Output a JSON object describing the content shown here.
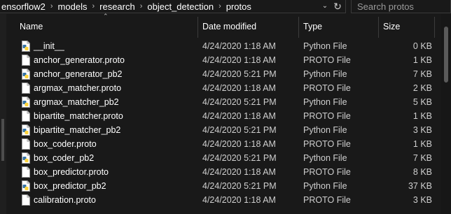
{
  "address_bar": {
    "crumbs": [
      "ensorflow2",
      "models",
      "research",
      "object_detection",
      "protos"
    ],
    "separator": "›"
  },
  "search": {
    "placeholder": "Search protos"
  },
  "columns": {
    "name": "Name",
    "date": "Date modified",
    "type": "Type",
    "size": "Size"
  },
  "files": [
    {
      "name": "__init__",
      "date": "4/24/2020 1:18 AM",
      "type": "Python File",
      "size": "0 KB",
      "icon": "python-file-icon"
    },
    {
      "name": "anchor_generator.proto",
      "date": "4/24/2020 1:18 AM",
      "type": "PROTO File",
      "size": "1 KB",
      "icon": "proto-file-icon"
    },
    {
      "name": "anchor_generator_pb2",
      "date": "4/24/2020 5:21 PM",
      "type": "Python File",
      "size": "7 KB",
      "icon": "python-file-icon"
    },
    {
      "name": "argmax_matcher.proto",
      "date": "4/24/2020 1:18 AM",
      "type": "PROTO File",
      "size": "2 KB",
      "icon": "proto-file-icon"
    },
    {
      "name": "argmax_matcher_pb2",
      "date": "4/24/2020 5:21 PM",
      "type": "Python File",
      "size": "5 KB",
      "icon": "python-file-icon"
    },
    {
      "name": "bipartite_matcher.proto",
      "date": "4/24/2020 1:18 AM",
      "type": "PROTO File",
      "size": "1 KB",
      "icon": "proto-file-icon"
    },
    {
      "name": "bipartite_matcher_pb2",
      "date": "4/24/2020 5:21 PM",
      "type": "Python File",
      "size": "3 KB",
      "icon": "python-file-icon"
    },
    {
      "name": "box_coder.proto",
      "date": "4/24/2020 1:18 AM",
      "type": "PROTO File",
      "size": "1 KB",
      "icon": "proto-file-icon"
    },
    {
      "name": "box_coder_pb2",
      "date": "4/24/2020 5:21 PM",
      "type": "Python File",
      "size": "7 KB",
      "icon": "python-file-icon"
    },
    {
      "name": "box_predictor.proto",
      "date": "4/24/2020 1:18 AM",
      "type": "PROTO File",
      "size": "8 KB",
      "icon": "proto-file-icon"
    },
    {
      "name": "box_predictor_pb2",
      "date": "4/24/2020 5:21 PM",
      "type": "Python File",
      "size": "37 KB",
      "icon": "python-file-icon"
    },
    {
      "name": "calibration.proto",
      "date": "4/24/2020 1:18 AM",
      "type": "PROTO File",
      "size": "3 KB",
      "icon": "proto-file-icon"
    }
  ],
  "colors": {
    "background": "#191919",
    "text": "#ffffff",
    "secondary_text": "#cfcfcf",
    "python_blue": "#3572a5",
    "python_yellow": "#ffd43b"
  }
}
